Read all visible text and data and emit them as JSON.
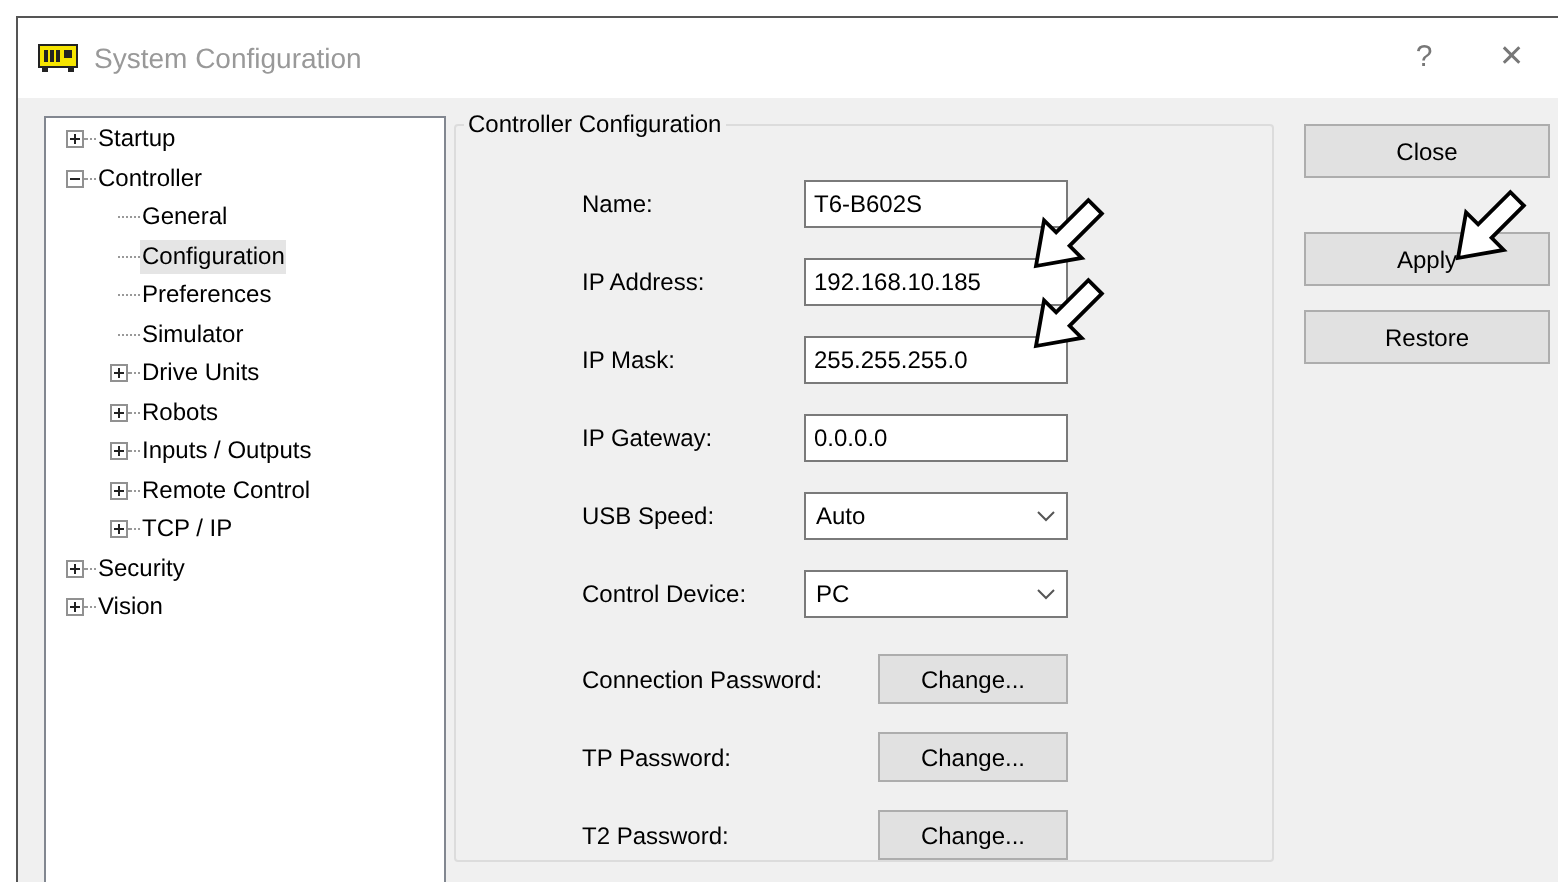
{
  "window": {
    "title": "System Configuration",
    "help_button": "?",
    "close_button": "✕"
  },
  "tree": [
    {
      "label": "Startup",
      "expanded": false,
      "selected": false
    },
    {
      "label": "Controller",
      "expanded": true,
      "selected": false,
      "children": [
        {
          "label": "General",
          "selected": false
        },
        {
          "label": "Configuration",
          "selected": true
        },
        {
          "label": "Preferences",
          "selected": false
        },
        {
          "label": "Simulator",
          "selected": false
        },
        {
          "label": "Drive Units",
          "expanded": false,
          "selected": false
        },
        {
          "label": "Robots",
          "expanded": false,
          "selected": false
        },
        {
          "label": "Inputs / Outputs",
          "expanded": false,
          "selected": false
        },
        {
          "label": "Remote Control",
          "expanded": false,
          "selected": false
        },
        {
          "label": "TCP / IP",
          "expanded": false,
          "selected": false
        }
      ]
    },
    {
      "label": "Security",
      "expanded": false,
      "selected": false
    },
    {
      "label": "Vision",
      "expanded": false,
      "selected": false
    }
  ],
  "group": {
    "title": "Controller Configuration",
    "fields": [
      {
        "kind": "text",
        "label": "Name:",
        "value": "T6-B602S"
      },
      {
        "kind": "text",
        "label": "IP Address:",
        "value": "192.168.10.185"
      },
      {
        "kind": "text",
        "label": "IP Mask:",
        "value": "255.255.255.0"
      },
      {
        "kind": "text",
        "label": "IP Gateway:",
        "value": "0.0.0.0"
      },
      {
        "kind": "dropdown",
        "label": "USB Speed:",
        "value": "Auto"
      },
      {
        "kind": "dropdown",
        "label": "Control Device:",
        "value": "PC"
      },
      {
        "kind": "button",
        "label": "Connection Password:",
        "value": "Change..."
      },
      {
        "kind": "button",
        "label": "TP Password:",
        "value": "Change..."
      },
      {
        "kind": "button",
        "label": "T2 Password:",
        "value": "Change..."
      }
    ]
  },
  "buttons": [
    "Close",
    "Apply",
    "Restore"
  ]
}
